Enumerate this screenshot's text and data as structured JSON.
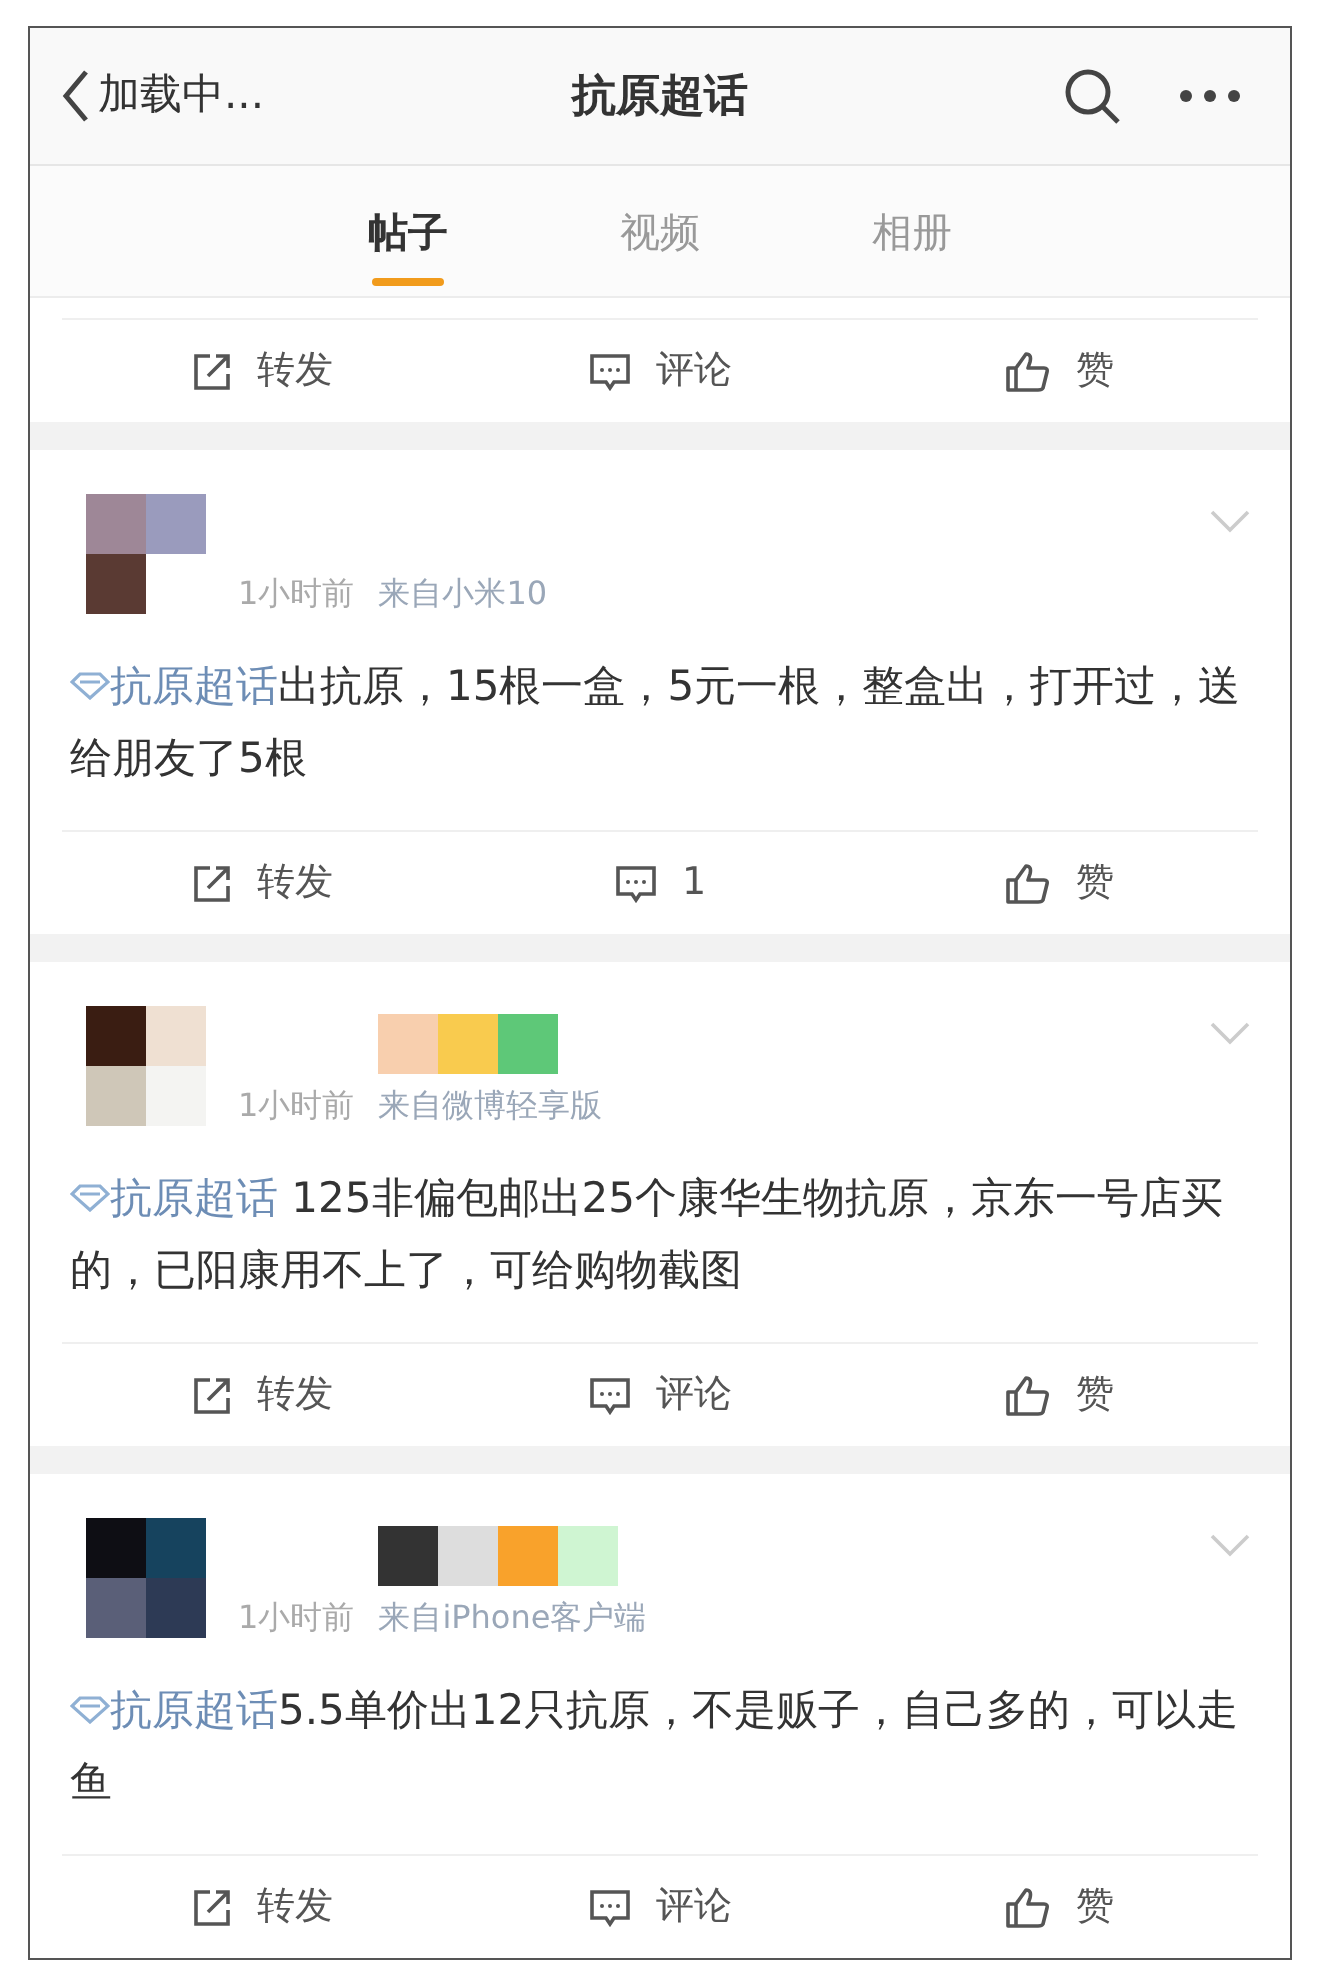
{
  "header": {
    "back_label": "加载中...",
    "title": "抗原超话"
  },
  "tabs": [
    {
      "label": "帖子",
      "selected": true
    },
    {
      "label": "视频",
      "selected": false
    },
    {
      "label": "相册",
      "selected": false
    }
  ],
  "top_actions": {
    "repost": "转发",
    "comment": "评论",
    "like": "赞"
  },
  "posts": [
    {
      "time": "1小时前",
      "source": "来自小米10",
      "topic": "抗原超话",
      "text": "出抗原，15根一盒，5元一根，整盒出，打开过，送给朋友了5根",
      "actions": {
        "repost": "转发",
        "comment": "1",
        "like": "赞"
      }
    },
    {
      "time": "1小时前",
      "source": "来自微博轻享版",
      "topic": "抗原超话",
      "text": " 125非偏包邮出25个康华生物抗原，京东一号店买的，已阳康用不上了，可给购物截图",
      "actions": {
        "repost": "转发",
        "comment": "评论",
        "like": "赞"
      }
    },
    {
      "time": "1小时前",
      "source": "来自iPhone客户端",
      "topic": "抗原超话",
      "text": "5.5单价出12只抗原，不是贩子，自己多的，可以走鱼",
      "actions": {
        "repost": "转发",
        "comment": "评论",
        "like": "赞"
      }
    }
  ]
}
